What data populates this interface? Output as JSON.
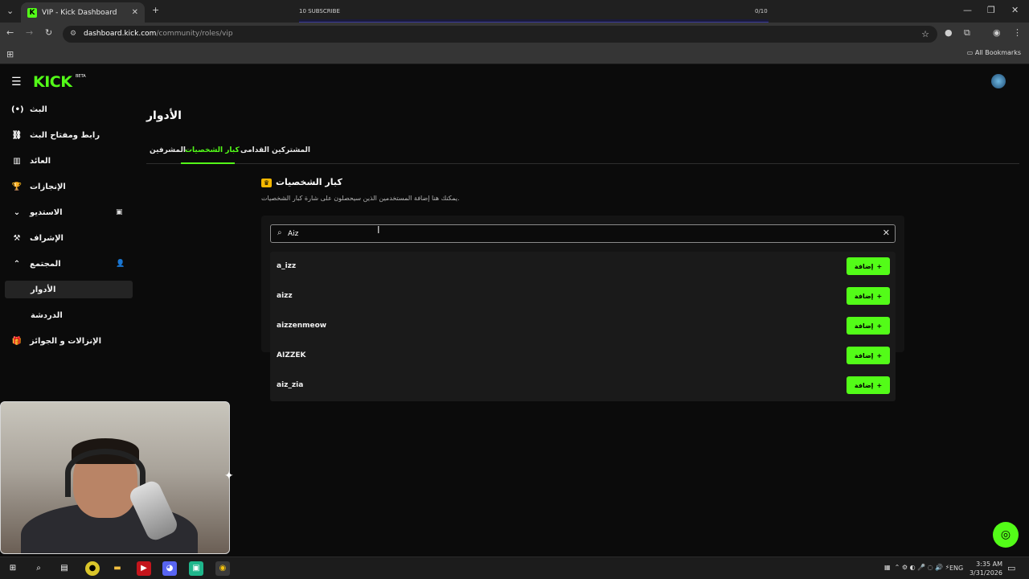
{
  "browser": {
    "tab_title": "VIP - Kick Dashboard",
    "tab_favicon": "K",
    "url_host": "dashboard.kick.com",
    "url_path": "/community/roles/vip",
    "all_bookmarks": "All Bookmarks",
    "overlay_subscribe": "10 SUBSCRIBE",
    "overlay_count": "0/10"
  },
  "app": {
    "logo": "KICK",
    "logo_badge": "BETA"
  },
  "sidebar": {
    "items": [
      {
        "label": "البث",
        "icon": "broadcast-icon"
      },
      {
        "label": "رابط ومفتاح البث",
        "icon": "link-icon"
      },
      {
        "label": "العائد",
        "icon": "chart-icon"
      },
      {
        "label": "الإنجازات",
        "icon": "trophy-icon"
      },
      {
        "label": "الاستديو",
        "icon": "chevron-down-icon"
      },
      {
        "label": "الإشراف",
        "icon": "hammer-icon"
      },
      {
        "label": "المجتمع",
        "icon": "chevron-up-icon"
      },
      {
        "label": "الأدوار",
        "icon": ""
      },
      {
        "label": "الدردشة",
        "icon": ""
      },
      {
        "label": "الإنزالات و الجوائز",
        "icon": "gift-icon"
      }
    ]
  },
  "main": {
    "title": "الأدوار",
    "tabs": [
      {
        "label": "المشرفين"
      },
      {
        "label": "كبار الشخصيات"
      },
      {
        "label": "المشتركين القدامى"
      }
    ],
    "section_title": "كبار الشخصيات",
    "section_desc": "يمكنك هنا إضافة المستخدمين الذين سيحصلون على شارة كبار الشخصيات.",
    "search": {
      "value": "Aiz",
      "placeholder": ""
    },
    "results": [
      {
        "name": "a_izz",
        "button": "إضافة"
      },
      {
        "name": "aizz",
        "button": "إضافة"
      },
      {
        "name": "aizzenmeow",
        "button": "إضافة"
      },
      {
        "name": "AIZZEK",
        "button": "إضافة"
      },
      {
        "name": "aiz_zia",
        "button": "إضافة"
      }
    ]
  },
  "taskbar": {
    "lang": "ENG",
    "time": "3:35 AM",
    "date": "3/31/2026"
  },
  "colors": {
    "accent": "#53fc18",
    "background": "#0b0b0b"
  }
}
